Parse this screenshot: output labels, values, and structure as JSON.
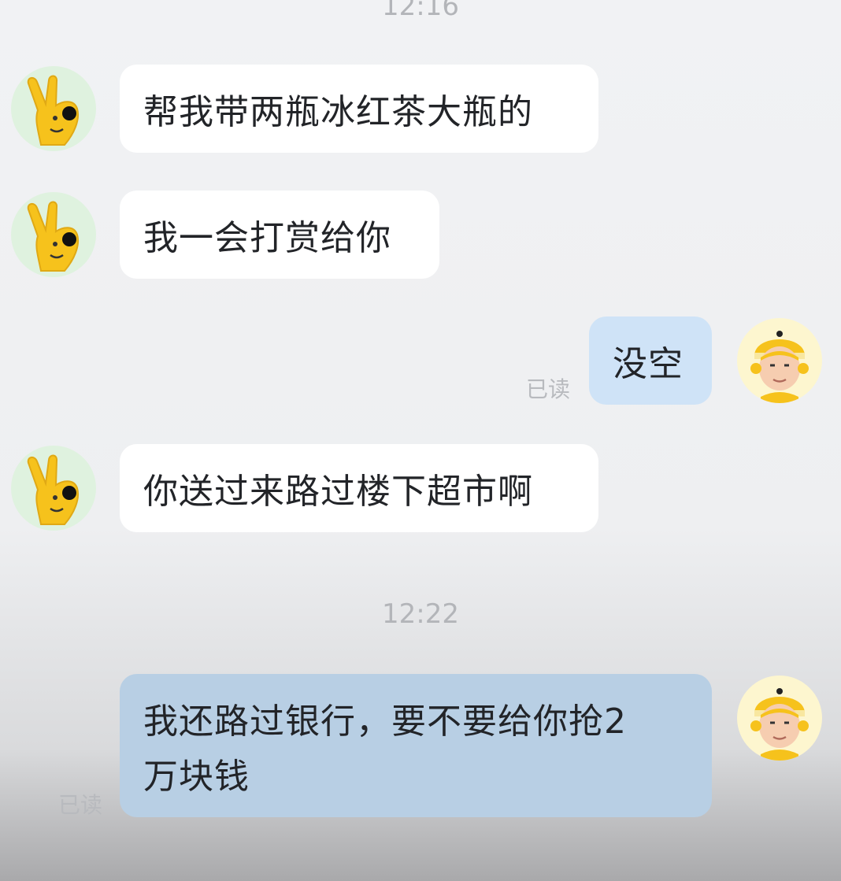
{
  "timestamps": [
    "12:16",
    "12:22"
  ],
  "messages": [
    {
      "side": "in",
      "text": "帮我带两瓶冰红茶大瓶的"
    },
    {
      "side": "in",
      "text": "我一会打赏给你"
    },
    {
      "side": "out",
      "text": "没空",
      "status": "已读"
    },
    {
      "side": "in",
      "text": "你送过来路过楼下超市啊"
    },
    {
      "side": "out",
      "text_line1": "我还路过银行，要不要给你抢2",
      "text_line2": "万块钱",
      "status": "已读"
    }
  ],
  "avatars": {
    "left": "hand-mascot-icon",
    "right": "delivery-rider-icon"
  },
  "colors": {
    "incoming_bubble": "#ffffff",
    "outgoing_bubble": "#cfe3f7",
    "background": "#f1f2f4",
    "mascot_yellow": "#f6c21c",
    "avatar_bg_left": "#dff2df",
    "avatar_bg_right": "#fdf6cf"
  }
}
